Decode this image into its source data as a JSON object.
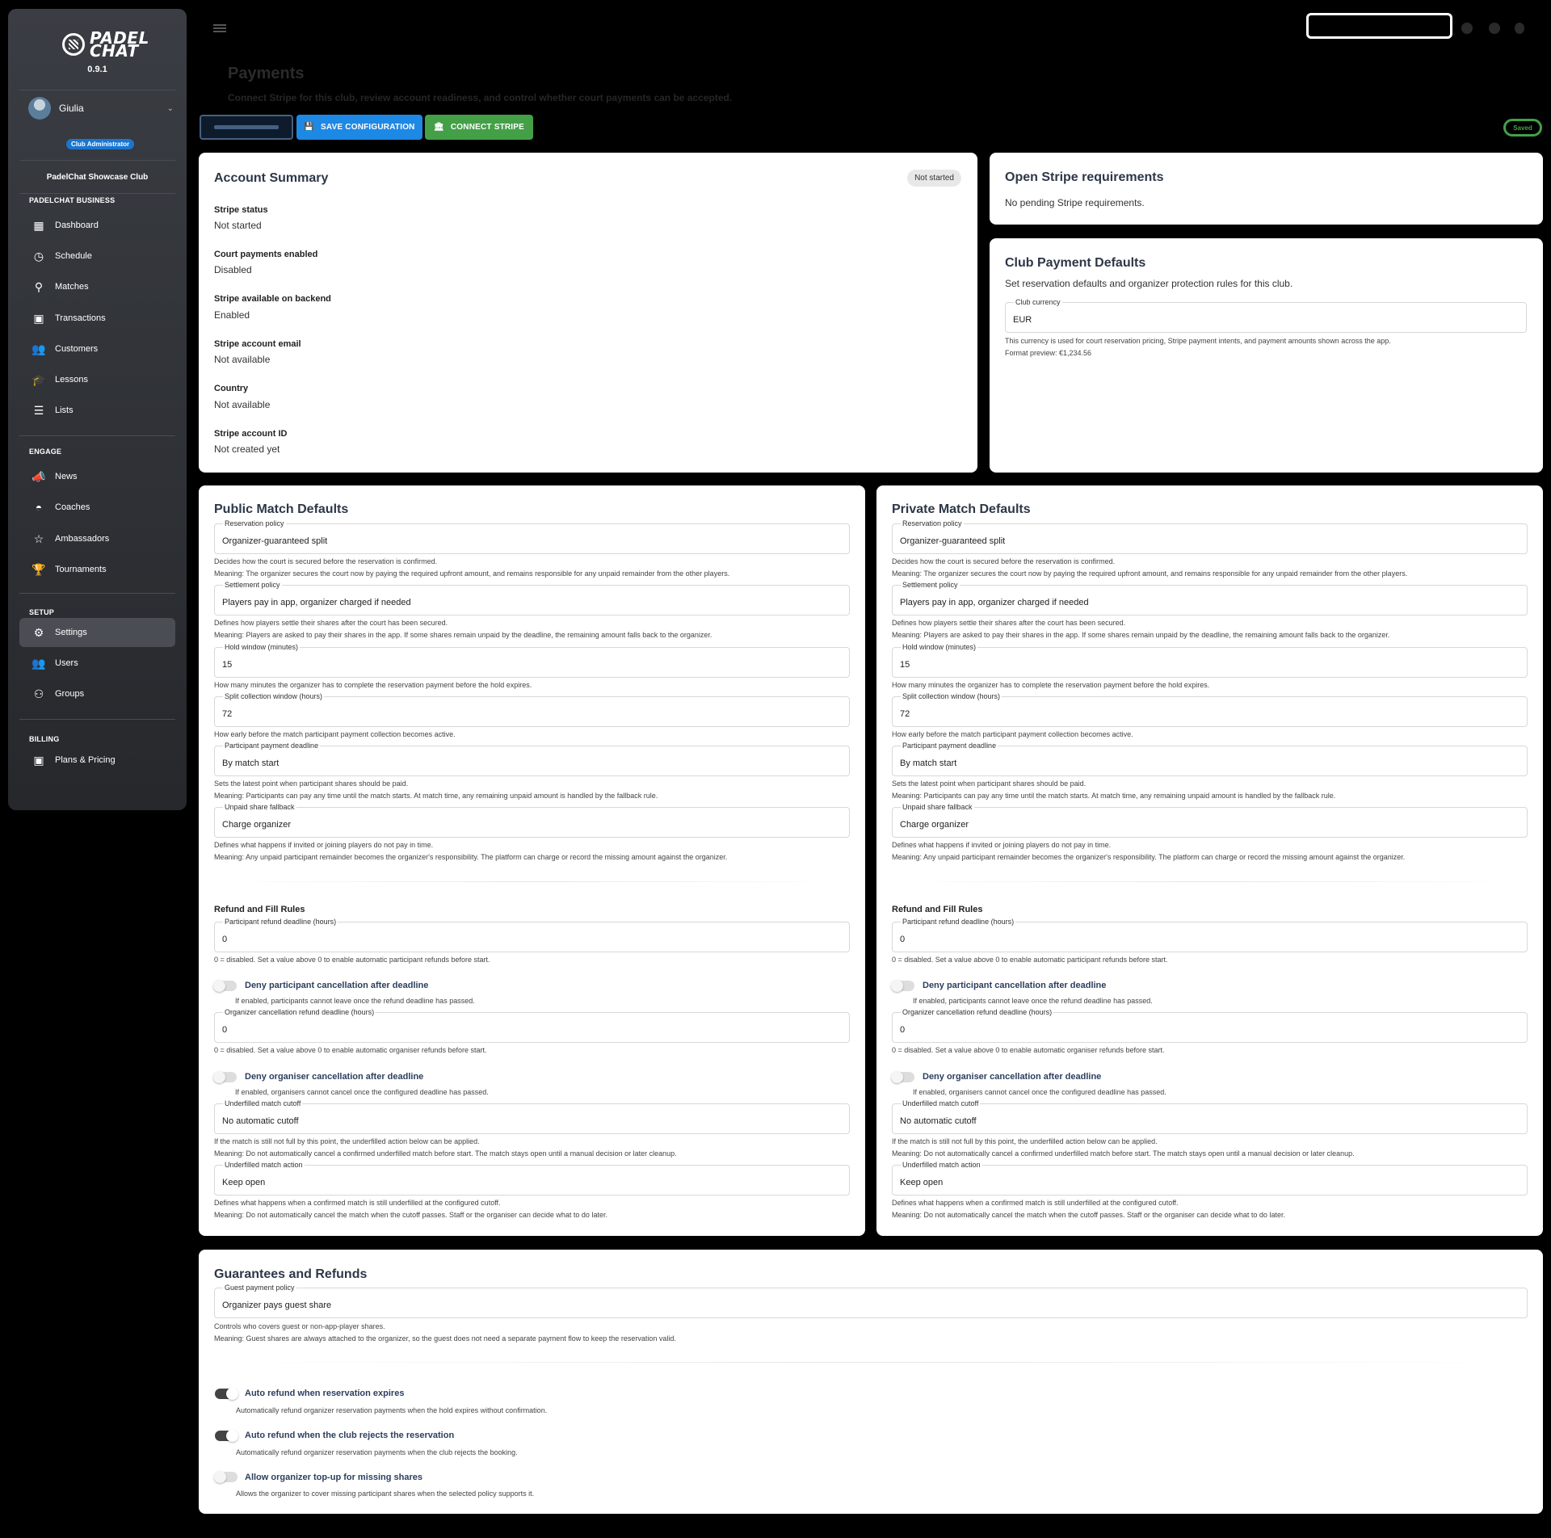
{
  "app": {
    "version": "0.9.1"
  },
  "sidebar": {
    "user": {
      "name": "Giulia",
      "role": "Club Administrator"
    },
    "club": "PadelChat Showcase Club",
    "sections": [
      {
        "title": "PADELCHAT BUSINESS",
        "items": [
          "Dashboard",
          "Schedule",
          "Matches",
          "Transactions",
          "Customers",
          "Lessons",
          "Lists"
        ]
      },
      {
        "title": "ENGAGE",
        "items": [
          "News",
          "Coaches",
          "Ambassadors",
          "Tournaments"
        ]
      },
      {
        "title": "SETUP",
        "items": [
          "Settings",
          "Users",
          "Groups"
        ]
      },
      {
        "title": "BILLING",
        "items": [
          "Plans & Pricing"
        ]
      }
    ],
    "active": "Settings"
  },
  "page": {
    "title": "Payments",
    "subtitle": "Connect Stripe for this club, review account readiness, and control whether court payments can be accepted.",
    "buttons": {
      "save": "SAVE CONFIGURATION",
      "connect": "CONNECT STRIPE"
    },
    "status_pill": "Saved"
  },
  "account_summary": {
    "title": "Account Summary",
    "badge": "Not started",
    "rows": [
      {
        "label": "Stripe status",
        "value": "Not started"
      },
      {
        "label": "Court payments enabled",
        "value": "Disabled"
      },
      {
        "label": "Stripe available on backend",
        "value": "Enabled"
      },
      {
        "label": "Stripe account email",
        "value": "Not available"
      },
      {
        "label": "Country",
        "value": "Not available"
      },
      {
        "label": "Stripe account ID",
        "value": "Not created yet"
      }
    ]
  },
  "requirements": {
    "title": "Open Stripe requirements",
    "text": "No pending Stripe requirements."
  },
  "club_defaults": {
    "title": "Club Payment Defaults",
    "subtitle": "Set reservation defaults and organizer protection rules for this club.",
    "currency_label": "Club currency",
    "currency_value": "EUR",
    "help1": "This currency is used for court reservation pricing, Stripe payment intents, and payment amounts shown across the app.",
    "help2": "Format preview: €1,234.56"
  },
  "match_defaults": {
    "public_title": "Public Match Defaults",
    "private_title": "Private Match Defaults",
    "fields": {
      "reservation_policy": {
        "label": "Reservation policy",
        "value": "Organizer-guaranteed split",
        "help1": "Decides how the court is secured before the reservation is confirmed.",
        "help2": "Meaning: The organizer secures the court now by paying the required upfront amount, and remains responsible for any unpaid remainder from the other players."
      },
      "settlement_policy": {
        "label": "Settlement policy",
        "value": "Players pay in app, organizer charged if needed",
        "help1": "Defines how players settle their shares after the court has been secured.",
        "help2": "Meaning: Players are asked to pay their shares in the app. If some shares remain unpaid by the deadline, the remaining amount falls back to the organizer."
      },
      "hold_window": {
        "label": "Hold window (minutes)",
        "value": "15",
        "help1": "How many minutes the organizer has to complete the reservation payment before the hold expires."
      },
      "split_window": {
        "label": "Split collection window (hours)",
        "value": "72",
        "help1": "How early before the match participant payment collection becomes active."
      },
      "participant_deadline": {
        "label": "Participant payment deadline",
        "value": "By match start",
        "help1": "Sets the latest point when participant shares should be paid.",
        "help2": "Meaning: Participants can pay any time until the match starts. At match time, any remaining unpaid amount is handled by the fallback rule."
      },
      "unpaid_fallback": {
        "label": "Unpaid share fallback",
        "value": "Charge organizer",
        "help1": "Defines what happens if invited or joining players do not pay in time.",
        "help2": "Meaning: Any unpaid participant remainder becomes the organizer's responsibility. The platform can charge or record the missing amount against the organizer."
      }
    },
    "refund_title": "Refund and Fill Rules",
    "refund": {
      "participant_refund": {
        "label": "Participant refund deadline (hours)",
        "value": "0",
        "help1": "0 = disabled. Set a value above 0 to enable automatic participant refunds before start."
      },
      "deny_participant": {
        "label": "Deny participant cancellation after deadline",
        "help": "If enabled, participants cannot leave once the refund deadline has passed."
      },
      "organizer_refund": {
        "label": "Organizer cancellation refund deadline (hours)",
        "value": "0",
        "help1": "0 = disabled. Set a value above 0 to enable automatic organiser refunds before start."
      },
      "deny_organiser": {
        "label": "Deny organiser cancellation after deadline",
        "help": "If enabled, organisers cannot cancel once the configured deadline has passed."
      },
      "underfilled_cutoff": {
        "label": "Underfilled match cutoff",
        "value": "No automatic cutoff",
        "help1": "If the match is still not full by this point, the underfilled action below can be applied.",
        "help2": "Meaning: Do not automatically cancel a confirmed underfilled match before start. The match stays open until a manual decision or later cleanup."
      },
      "underfilled_action": {
        "label": "Underfilled match action",
        "value": "Keep open",
        "help1": "Defines what happens when a confirmed match is still underfilled at the configured cutoff.",
        "help2": "Meaning: Do not automatically cancel the match when the cutoff passes. Staff or the organiser can decide what to do later."
      }
    }
  },
  "guarantees": {
    "title": "Guarantees and Refunds",
    "guest_label": "Guest payment policy",
    "guest_value": "Organizer pays guest share",
    "help1": "Controls who covers guest or non-app-player shares.",
    "help2": "Meaning: Guest shares are always attached to the organizer, so the guest does not need a separate payment flow to keep the reservation valid.",
    "toggles": [
      {
        "label": "Auto refund when reservation expires",
        "help": "Automatically refund organizer reservation payments when the hold expires without confirmation.",
        "on": true
      },
      {
        "label": "Auto refund when the club rejects the reservation",
        "help": "Automatically refund organizer reservation payments when the club rejects the booking.",
        "on": true
      },
      {
        "label": "Allow organizer top-up for missing shares",
        "help": "Allows the organizer to cover missing participant shares when the selected policy supports it.",
        "on": false
      }
    ]
  },
  "colors": {
    "accent_blue": "#1e88e5",
    "accent_green": "#43a047",
    "sidebar": "#2f3236"
  }
}
